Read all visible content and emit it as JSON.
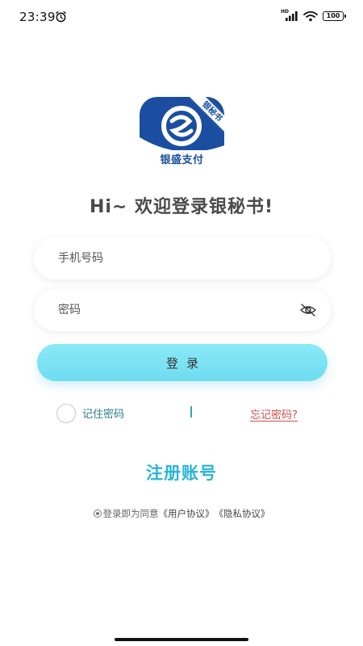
{
  "status_bar": {
    "time": "23:39",
    "network_label": "HD",
    "battery": "100"
  },
  "logo": {
    "name": "银盛支付",
    "ribbon": "银秘书",
    "brand_color": "#1b4ea0"
  },
  "welcome": "Hi~ 欢迎登录银秘书!",
  "form": {
    "phone_placeholder": "手机号码",
    "password_placeholder": "密码",
    "login_label": "登录",
    "remember_label": "记住密码",
    "separator": "|",
    "forgot_label": "忘记密码?"
  },
  "register_label": "注册账号",
  "agreement": {
    "prefix": "登录即为同意",
    "user_agreement": "《用户协议》",
    "privacy_policy": "《隐私协议》"
  },
  "colors": {
    "accent": "#28b4d6",
    "button": "#7ee3f4",
    "forgot": "#d34b4b"
  },
  "icons": [
    "alarm-icon",
    "signal-icon",
    "wifi-icon",
    "battery-icon",
    "eye-off-icon"
  ]
}
